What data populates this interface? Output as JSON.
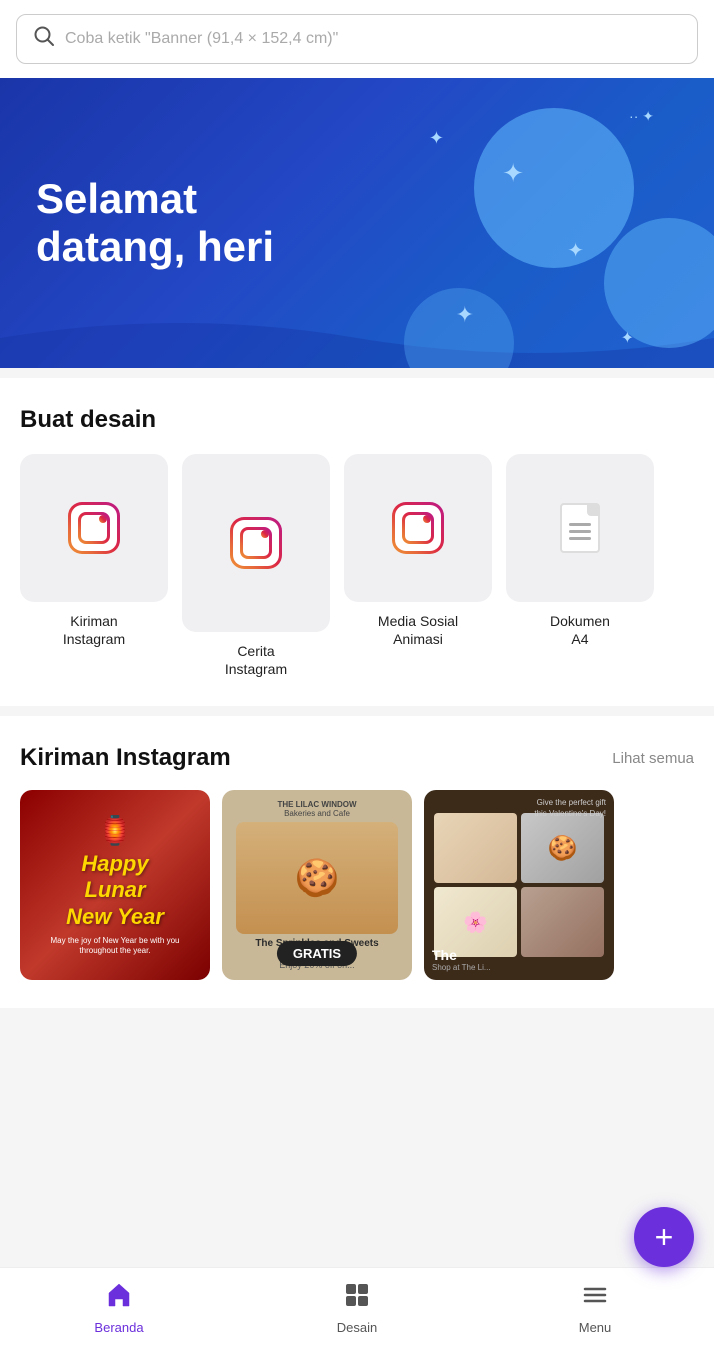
{
  "search": {
    "placeholder": "Coba ketik \"Banner (91,4 × 152,4 cm)\""
  },
  "hero": {
    "greeting": "Selamat datang, heri"
  },
  "design_section": {
    "title": "Buat desain",
    "cards": [
      {
        "id": "kiriman-instagram",
        "label": "Kiriman Instagram",
        "icon_type": "instagram"
      },
      {
        "id": "cerita-instagram",
        "label": "Cerita Instagram",
        "icon_type": "instagram"
      },
      {
        "id": "media-sosial-animasi",
        "label": "Media Sosial Animasi",
        "icon_type": "instagram"
      },
      {
        "id": "dokumen-a4",
        "label": "Dokumen A4",
        "icon_type": "document"
      }
    ]
  },
  "instagram_section": {
    "title": "Kiriman Instagram",
    "see_all": "Lihat semua",
    "posts": [
      {
        "id": "lunar-new-year",
        "type": "lunar",
        "title": "Happy Lunar New Year",
        "subtitle": "May the joy of New Year be with you throughout the year."
      },
      {
        "id": "sprinkles-sweets",
        "type": "cookie",
        "shop": "THE LILAC WINDOW",
        "shop_sub": "Bakeries and Cafe",
        "title": "The Sprinkles and Sweets Valen...",
        "subtitle": "Enjoy 20% off on...",
        "badge": "GRATIS"
      },
      {
        "id": "the-biscuits",
        "type": "biscuits",
        "top_text": "Give the perfect gift this Valentine's Day!",
        "title": "The",
        "bottom_text": "Shop at The Li..."
      }
    ]
  },
  "fab": {
    "label": "+"
  },
  "bottom_nav": {
    "items": [
      {
        "id": "beranda",
        "label": "Beranda",
        "active": true,
        "icon": "home"
      },
      {
        "id": "desain",
        "label": "Desain",
        "active": false,
        "icon": "grid"
      },
      {
        "id": "menu",
        "label": "Menu",
        "active": false,
        "icon": "menu"
      }
    ]
  }
}
